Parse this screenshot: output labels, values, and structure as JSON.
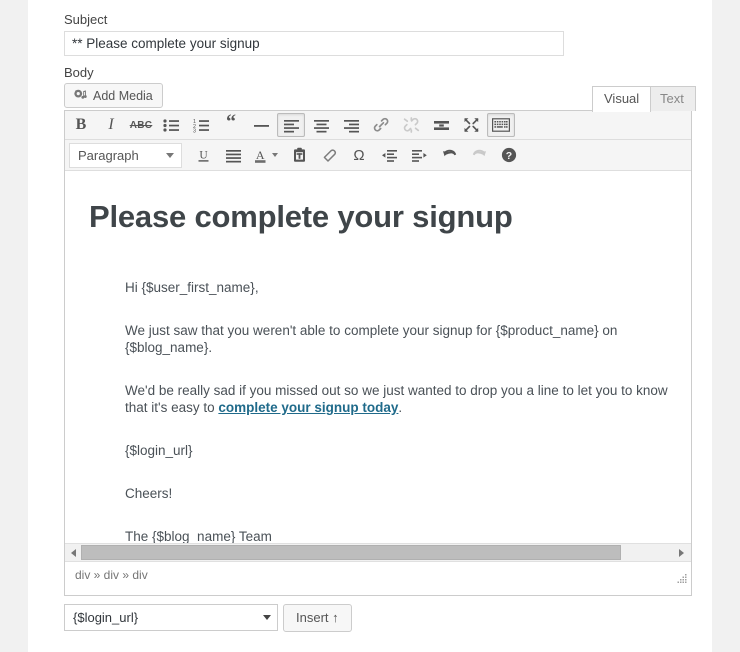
{
  "form": {
    "subject_label": "Subject",
    "subject_value": "** Please complete your signup",
    "body_label": "Body"
  },
  "media": {
    "add_media_label": "Add Media",
    "icon": "media-icon"
  },
  "editor_tabs": {
    "visual": "Visual",
    "text": "Text",
    "active": "Visual"
  },
  "toolbar_row1": [
    {
      "name": "bold-button",
      "label": "B",
      "glyph": "B",
      "active": false,
      "disabled": false
    },
    {
      "name": "italic-button",
      "label": "I",
      "glyph": "I",
      "active": false,
      "disabled": false
    },
    {
      "name": "strikethrough-button",
      "label": "ABC",
      "glyph": "ABC",
      "active": false,
      "disabled": false
    },
    {
      "name": "bulleted-list-button",
      "label": "Bulleted list",
      "glyph": "ul-icon",
      "active": false,
      "disabled": false
    },
    {
      "name": "numbered-list-button",
      "label": "Numbered list",
      "glyph": "ol-icon",
      "active": false,
      "disabled": false
    },
    {
      "name": "blockquote-button",
      "label": "Blockquote",
      "glyph": "quote-icon",
      "active": false,
      "disabled": false
    },
    {
      "name": "horizontal-rule-button",
      "label": "Horizontal line",
      "glyph": "hr-icon",
      "active": false,
      "disabled": false
    },
    {
      "name": "align-left-button",
      "label": "Align left",
      "glyph": "align-left-icon",
      "active": true,
      "disabled": false
    },
    {
      "name": "align-center-button",
      "label": "Align center",
      "glyph": "align-center-icon",
      "active": false,
      "disabled": false
    },
    {
      "name": "align-right-button",
      "label": "Align right",
      "glyph": "align-right-icon",
      "active": false,
      "disabled": false
    },
    {
      "name": "insert-link-button",
      "label": "Insert link",
      "glyph": "link-icon",
      "active": false,
      "disabled": false
    },
    {
      "name": "remove-link-button",
      "label": "Remove link",
      "glyph": "unlink-icon",
      "active": false,
      "disabled": true
    },
    {
      "name": "read-more-button",
      "label": "Insert Read More tag",
      "glyph": "read-more-icon",
      "active": false,
      "disabled": false
    },
    {
      "name": "fullscreen-button",
      "label": "Distraction-free writing mode",
      "glyph": "fullscreen-icon",
      "active": false,
      "disabled": false
    },
    {
      "name": "toolbar-toggle-button",
      "label": "Toolbar Toggle",
      "glyph": "kitchen-sink-icon",
      "active": true,
      "disabled": false
    }
  ],
  "toolbar_row2": {
    "format_select_value": "Paragraph",
    "buttons": [
      {
        "name": "underline-button",
        "label": "Underline",
        "glyph": "underline-icon",
        "active": false,
        "disabled": false
      },
      {
        "name": "justify-button",
        "label": "Justify",
        "glyph": "align-justify-icon",
        "active": false,
        "disabled": false
      },
      {
        "name": "text-color-button",
        "label": "Text color",
        "glyph": "text-color-icon",
        "active": false,
        "disabled": false
      },
      {
        "name": "paste-as-text-button",
        "label": "Paste as text",
        "glyph": "clipboard-icon",
        "active": false,
        "disabled": false
      },
      {
        "name": "clear-formatting-button",
        "label": "Clear formatting",
        "glyph": "eraser-icon",
        "active": false,
        "disabled": false
      },
      {
        "name": "special-character-button",
        "label": "Ω",
        "glyph": "omega-icon",
        "active": false,
        "disabled": false
      },
      {
        "name": "outdent-button",
        "label": "Decrease indent",
        "glyph": "outdent-icon",
        "active": false,
        "disabled": false
      },
      {
        "name": "indent-button",
        "label": "Increase indent",
        "glyph": "indent-icon",
        "active": false,
        "disabled": false
      },
      {
        "name": "undo-button",
        "label": "Undo",
        "glyph": "undo-icon",
        "active": false,
        "disabled": false
      },
      {
        "name": "redo-button",
        "label": "Redo",
        "glyph": "redo-icon",
        "active": false,
        "disabled": true
      },
      {
        "name": "keyboard-shortcuts-button",
        "label": "Keyboard Shortcuts",
        "glyph": "help-icon",
        "active": false,
        "disabled": false
      }
    ]
  },
  "email": {
    "heading": "Please complete your signup",
    "paragraphs": [
      {
        "text": "Hi {$user_first_name},"
      },
      {
        "text": "We just saw that you weren't able to complete your signup for {$product_name} on {$blog_name}."
      }
    ],
    "link_paragraph": {
      "before": "We'd be really sad if you missed out so we just wanted to drop you a line to let you to know that it's easy to ",
      "link_text": "complete your signup today",
      "after": "."
    },
    "paragraphs_after": [
      {
        "text": "{$login_url}"
      },
      {
        "text": "Cheers!"
      },
      {
        "text": "The {$blog_name} Team"
      }
    ],
    "link_color": "#1f6a8a"
  },
  "statusbar": {
    "path": "div » div » div"
  },
  "bottom": {
    "shortcode_value": "{$login_url}",
    "insert_label": "Insert ↑"
  }
}
